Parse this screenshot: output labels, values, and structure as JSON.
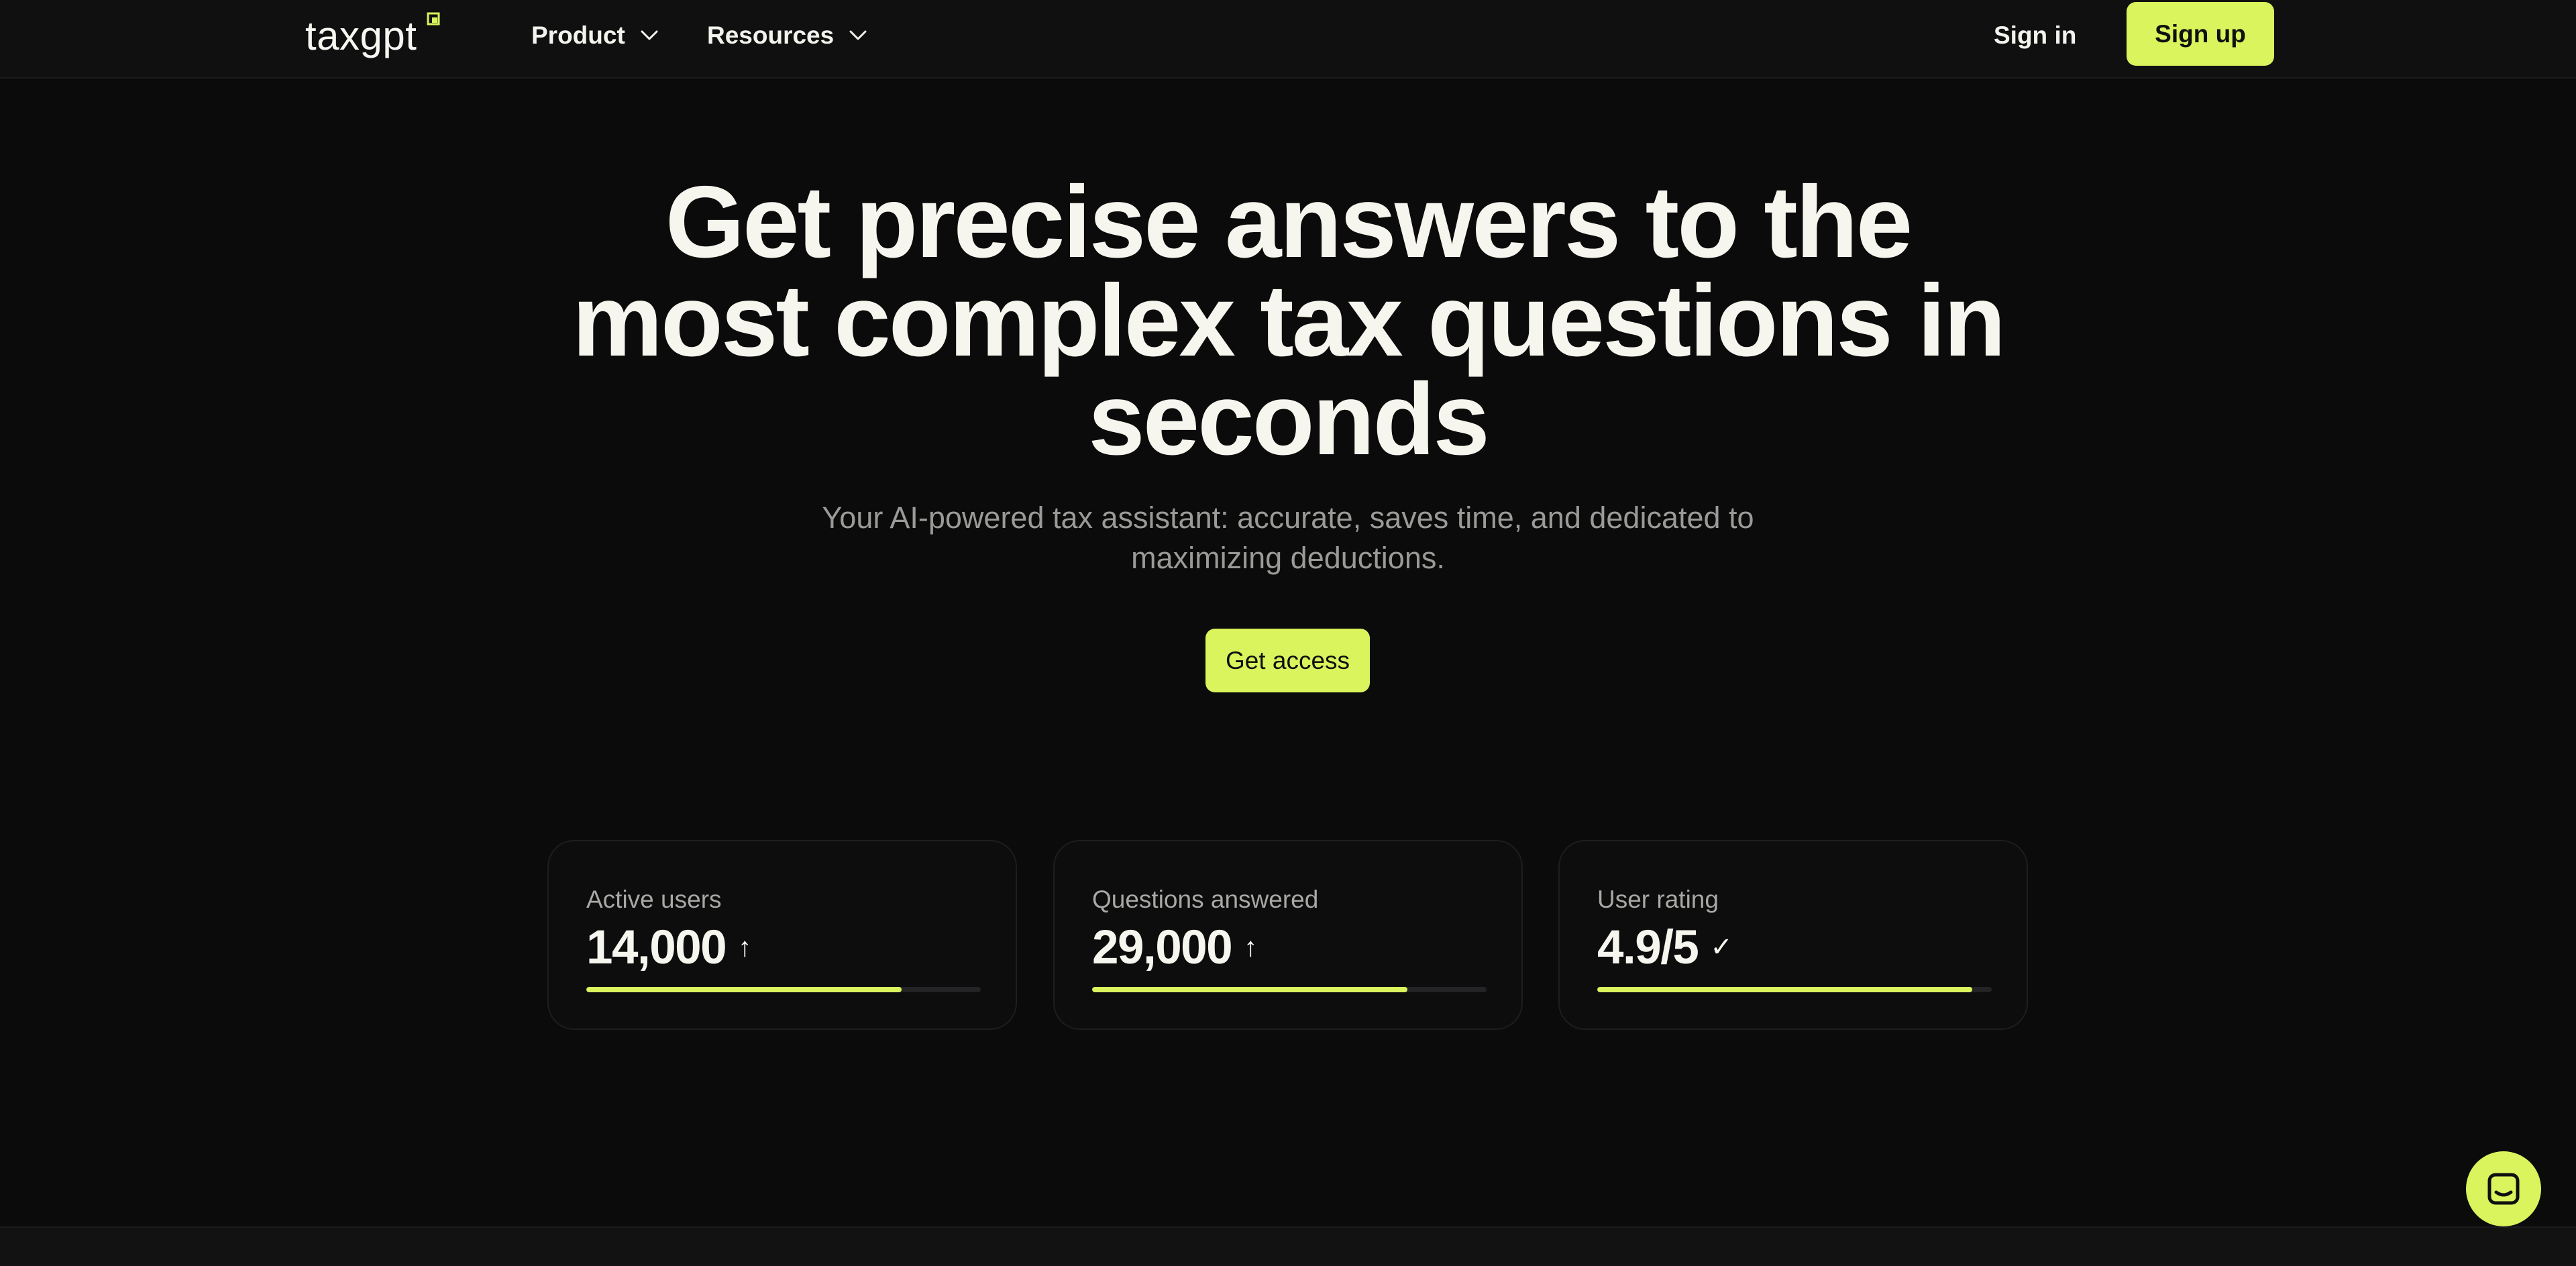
{
  "header": {
    "logo_text": "taxgpt",
    "nav": [
      {
        "label": "Product"
      },
      {
        "label": "Resources"
      }
    ],
    "signin_label": "Sign in",
    "signup_label": "Sign up"
  },
  "hero": {
    "title": "Get precise answers to the most complex tax questions in seconds",
    "subtitle": "Your AI-powered tax assistant: accurate, saves time, and dedicated to maximizing deductions.",
    "cta_label": "Get access"
  },
  "stats": [
    {
      "label": "Active users",
      "value": "14,000",
      "glyph": "↑",
      "progress": 0.8
    },
    {
      "label": "Questions answered",
      "value": "29,000",
      "glyph": "↑",
      "progress": 0.8
    },
    {
      "label": "User rating",
      "value": "4.9/5",
      "glyph": "✓",
      "progress": 0.95
    }
  ],
  "colors": {
    "accent": "#d9f45c",
    "background": "#0b0b0c",
    "header_background": "#101011",
    "text": "#f6f6ee",
    "muted_text": "#9a9a97"
  },
  "icons": {
    "logo_mark": "square-corner-icon",
    "nav_chevron": "chevron-down-icon",
    "chat": "chat-icon"
  }
}
